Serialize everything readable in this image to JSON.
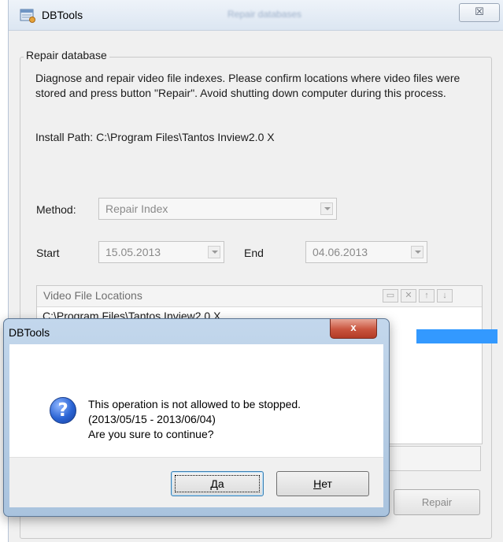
{
  "main_window": {
    "title": "DBTools",
    "ghost_tab": "Repair databases",
    "close_glyph": "☒"
  },
  "repair_group": {
    "legend": "Repair database",
    "description": "Diagnose and repair video file indexes. Please confirm locations where video files were stored and press button \"Repair\". Avoid shutting down computer during this process.",
    "install_label": "Install Path:",
    "install_path": "C:\\Program Files\\Tantos Inview2.0 X",
    "method_label": "Method:",
    "method_value": "Repair Index",
    "start_label": "Start",
    "start_value": "15.05.2013",
    "end_label": "End",
    "end_value": "04.06.2013",
    "locations": {
      "header": "Video File Locations",
      "toolbar": [
        "folder-add-icon",
        "delete-icon",
        "arrow-up-icon",
        "arrow-down-icon"
      ],
      "rows": [
        "C:\\Program Files\\Tantos Inview2.0 X"
      ]
    },
    "repair_button": "Repair"
  },
  "dialog": {
    "title": "DBTools",
    "close_glyph": "x",
    "icon": "question-icon",
    "message_lines": [
      "This operation is not allowed to be stopped.",
      "(2013/05/15 - 2013/06/04)",
      "Are you sure to continue?"
    ],
    "yes_button": {
      "hotkey": "Д",
      "rest": "а"
    },
    "no_button": {
      "hotkey": "Н",
      "rest": "ет"
    }
  },
  "colors": {
    "selection": "#3399ff",
    "dialog_frame": "#a9c3de",
    "close_red": "#c9543e"
  }
}
